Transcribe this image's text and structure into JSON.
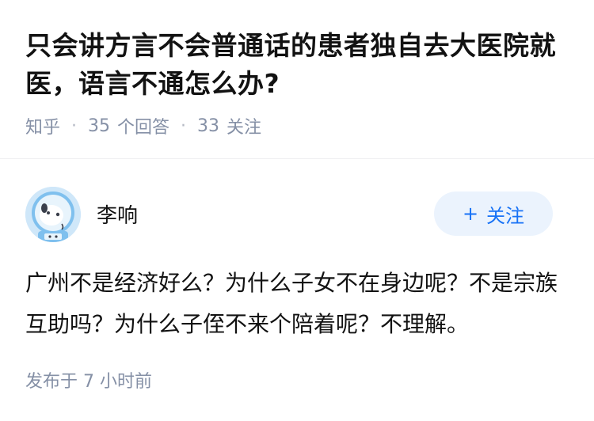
{
  "question": {
    "title": "只会讲方言不会普通话的患者独自去大医院就医，语言不通怎么办?",
    "source": "知乎",
    "answers_count": "35",
    "answers_label": "个回答",
    "followers_count": "33",
    "followers_label": "关注"
  },
  "answer": {
    "author_name": "李响",
    "follow_plus": "+",
    "follow_label": "关注",
    "content": "广州不是经济好么？为什么子女不在身边呢？不是宗族互助吗？为什么子侄不来个陪着呢？不理解。",
    "published": "发布于  7 小时前"
  },
  "colors": {
    "accent": "#1772f6",
    "follow_bg": "#ebf3fd",
    "meta": "#8590a6",
    "avatar_bg": "#cfe7f9"
  }
}
